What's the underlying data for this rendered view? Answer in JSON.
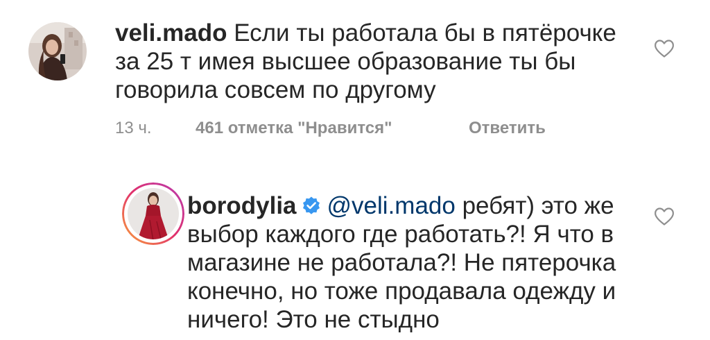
{
  "comments": [
    {
      "username": "veli.mado",
      "text_lines": [
        "Если ты работала бы в пятёрочке",
        "за 25 т имея высшее образование ты бы",
        "говорила совсем по другому"
      ],
      "time": "13 ч.",
      "likes": "461 отметка \"Нравится\"",
      "reply_label": "Ответить",
      "avatar": "avatar-woman-mirror-selfie",
      "like_icon": "heart-outline-icon"
    },
    {
      "username": "borodylia",
      "verified_icon": "verified-badge-icon",
      "mention": "@veli.mado",
      "text_first_rest": " ребят) это же",
      "text_lines": [
        "выбор каждого где работать?! Я что в",
        "магазине не работала?! Не пятерочка",
        "конечно, но тоже продавала одежду и",
        "ничего! Это не стыдно"
      ],
      "avatar": "avatar-woman-red-dress-story-ring",
      "like_icon": "heart-outline-icon"
    }
  ],
  "colors": {
    "text": "#262626",
    "secondary": "#8e8e8e",
    "mention": "#00376b",
    "verified": "#3897f0"
  }
}
